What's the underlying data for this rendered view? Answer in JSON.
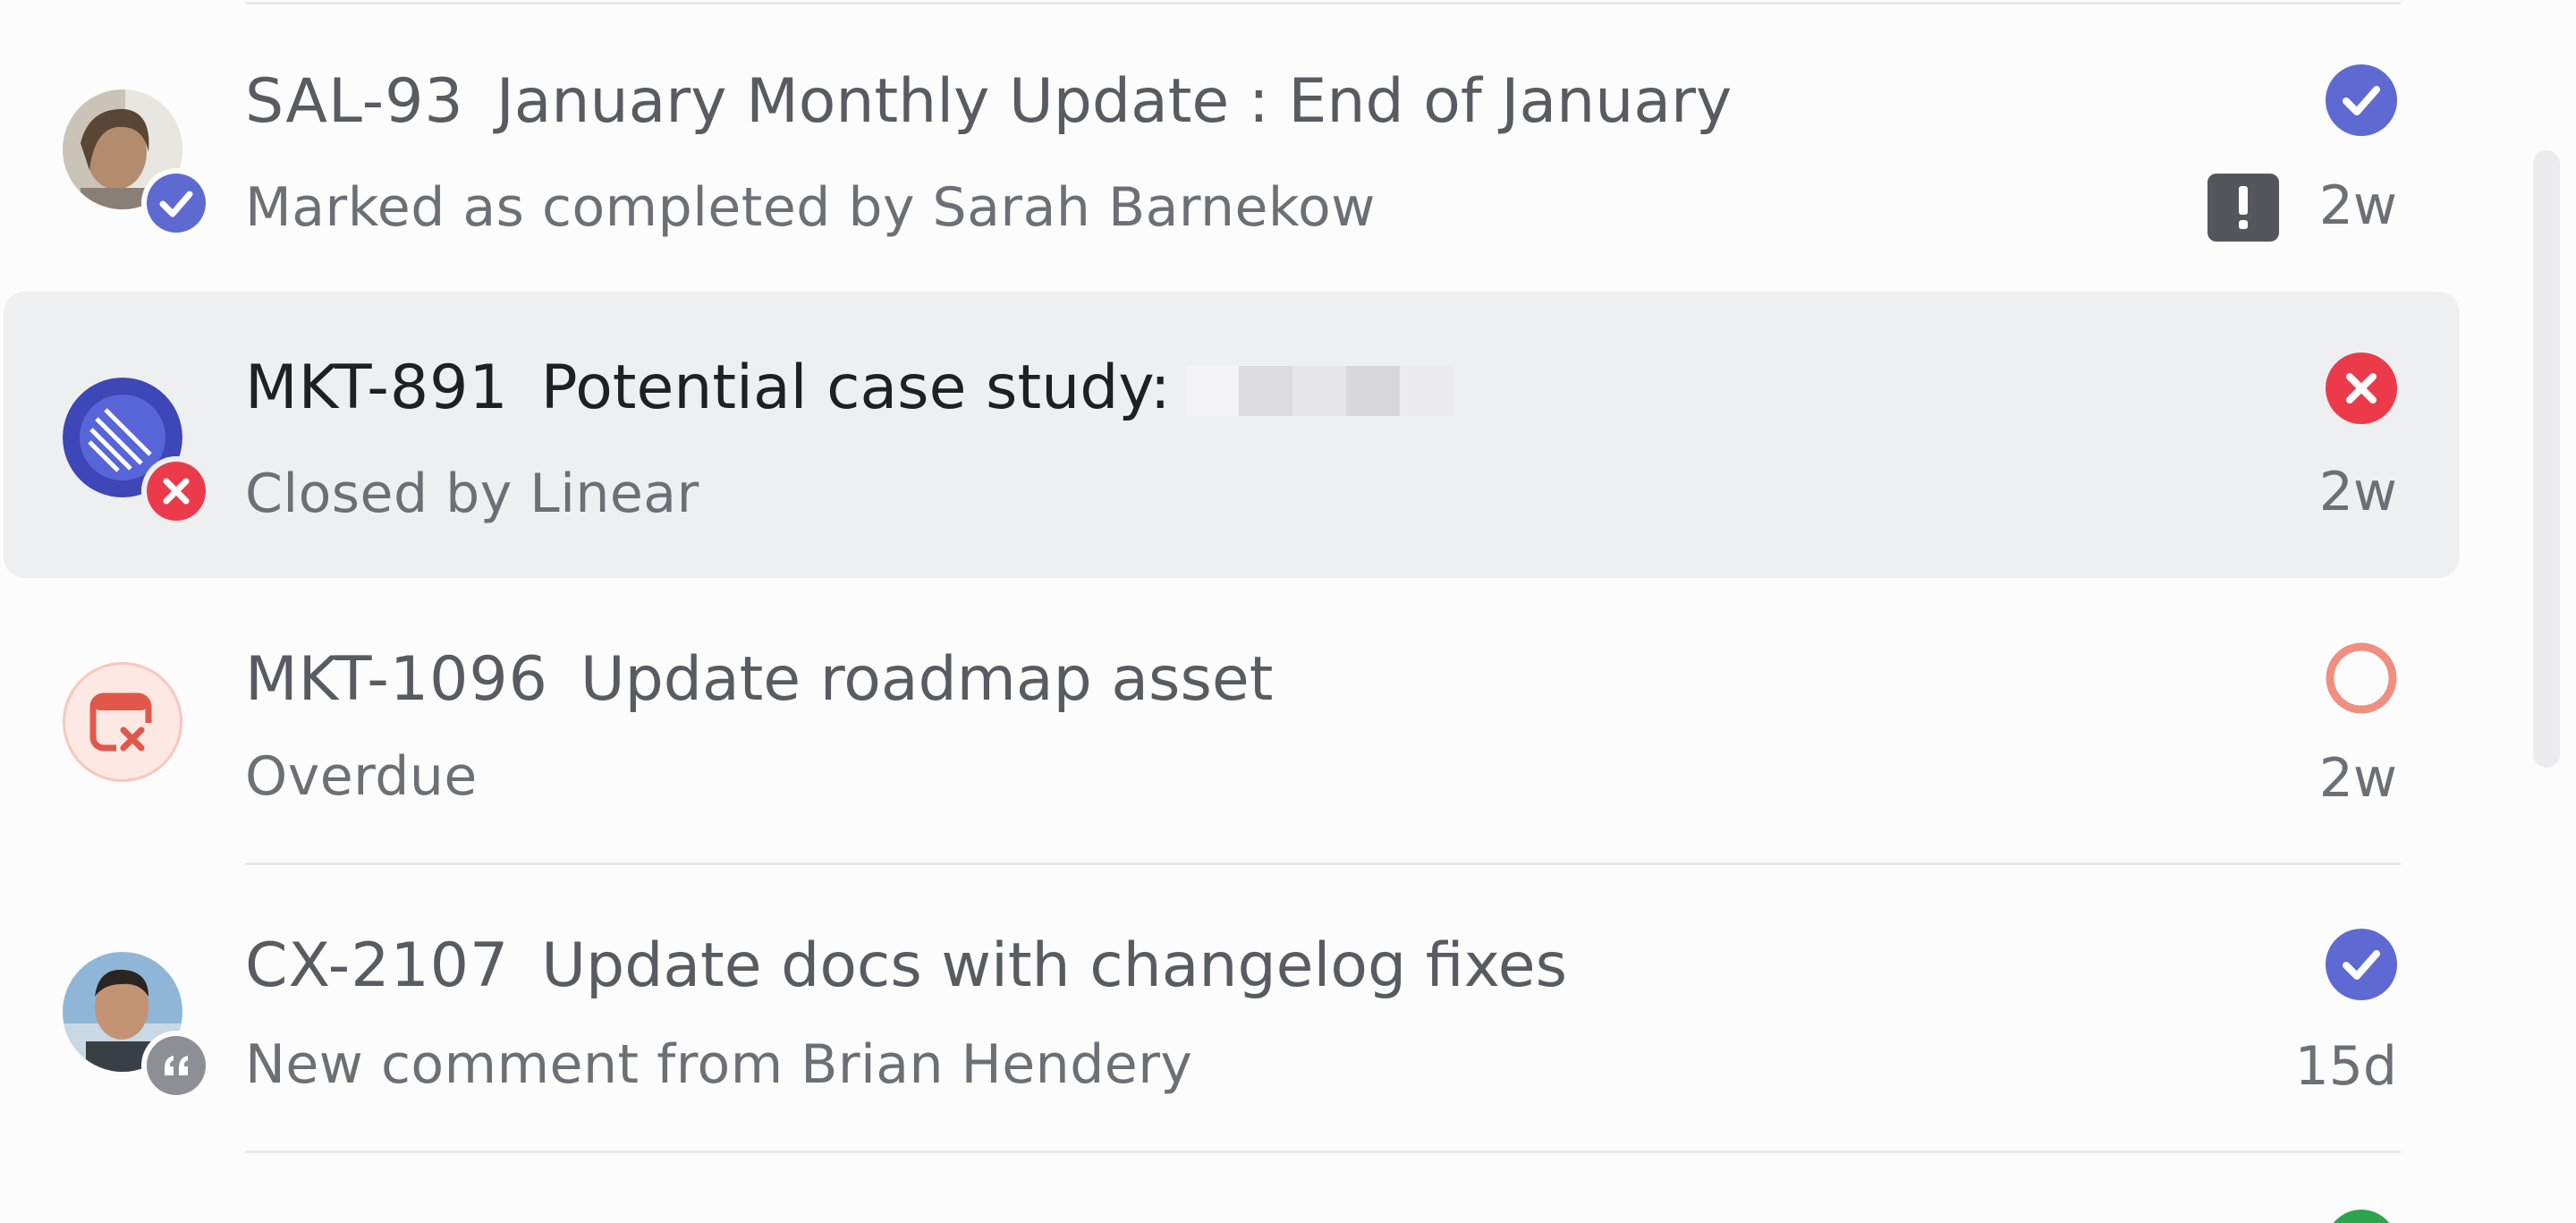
{
  "colors": {
    "done_purple": "#5e6ad2",
    "cancel_red": "#eb3b4b",
    "overdue_red": "#e5796a",
    "comment_gray": "#8e8f95",
    "next_green": "#2ea44f"
  },
  "notifications": [
    {
      "issue_id": "SAL-93",
      "title": "January Monthly Update : End of January",
      "subtitle": "Marked as completed by Sarah Barnekow",
      "time": "2w",
      "status_icon": "completed-check-icon",
      "badge_icon": "completed-check-icon",
      "avatar": "user-avatar",
      "priority_icon": "urgent-priority-icon"
    },
    {
      "issue_id": "MKT-891",
      "title": "Potential case study:",
      "subtitle": "Closed by Linear",
      "time": "2w",
      "status_icon": "canceled-x-icon",
      "badge_icon": "canceled-x-icon",
      "avatar": "linear-logo-avatar",
      "selected": true
    },
    {
      "issue_id": "MKT-1096",
      "title": "Update roadmap asset",
      "subtitle": "Overdue",
      "time": "2w",
      "status_icon": "todo-circle-icon",
      "avatar": "calendar-overdue-icon"
    },
    {
      "issue_id": "CX-2107",
      "title": "Update docs with changelog fixes",
      "subtitle": "New comment from Brian Hendery",
      "time": "15d",
      "status_icon": "completed-check-icon",
      "badge_icon": "comment-quote-icon",
      "avatar": "user-avatar"
    }
  ]
}
